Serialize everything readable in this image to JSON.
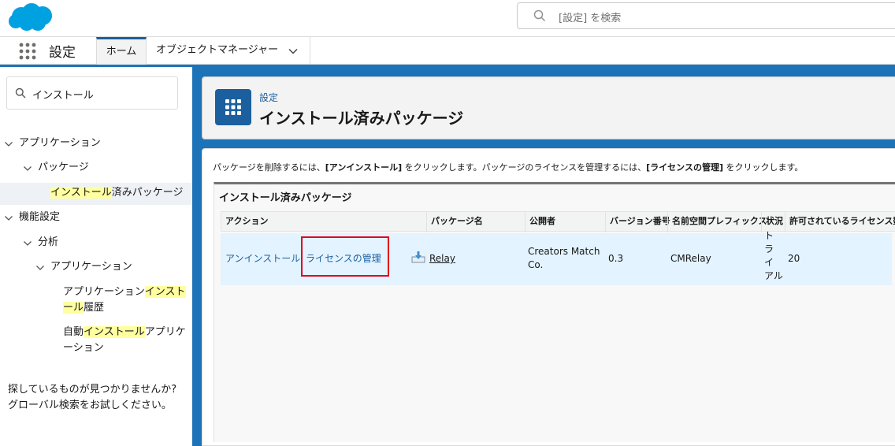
{
  "header": {
    "search_placeholder": "[設定] を検索",
    "brand_color": "#00a1e0"
  },
  "nav": {
    "app_name": "設定",
    "tabs": [
      {
        "label": "ホーム"
      },
      {
        "label": "オブジェクトマネージャー"
      }
    ]
  },
  "sidebar": {
    "quick_find_value": "インストール",
    "tree": {
      "applications": "アプリケーション",
      "packages": "パッケージ",
      "installed_hl": "インストール",
      "installed_rest": "済みパッケージ",
      "feature_settings": "機能設定",
      "analytics": "分析",
      "analytics_apps": "アプリケーション",
      "install_history_a": "アプリケーション",
      "install_history_hl1": "インスト",
      "install_history_hl2": "ール",
      "install_history_b": "履歴",
      "auto_a": "自動",
      "auto_hl": "インストール",
      "auto_b": "アプリケ",
      "auto_c": "ーション"
    },
    "help_line1": "探しているものが見つかりませんか?",
    "help_line2": "グローバル検索をお試しください。"
  },
  "page_header": {
    "breadcrumb": "設定",
    "title": "インストール済みパッケージ"
  },
  "content": {
    "desc_1": "パッケージを削除するには、",
    "desc_b1": "[アンインストール]",
    "desc_2": " をクリックします。パッケージのライセンスを管理するには、",
    "desc_b2": "[ライセンスの管理]",
    "desc_3": " をクリックします。",
    "section_title": "インストール済みパッケージ",
    "columns": [
      "アクション",
      "パッケージ名",
      "公開者",
      "バージョン番号",
      "名前空間プレフィックス",
      "状況",
      "許可されているライセンス数"
    ],
    "rows": [
      {
        "uninstall": "アンインストール",
        "manage_licenses": "ライセンスの管理",
        "package_name": "Relay",
        "publisher_1": "Creators Match",
        "publisher_2": "Co.",
        "version": "0.3",
        "namespace": "CMRelay",
        "status_chars": [
          "ト",
          "ラ",
          "イ",
          "アル"
        ],
        "licenses": "20"
      }
    ]
  },
  "colors": {
    "accent": "#1b5f9e",
    "highlight_box": "#e0001b",
    "selected_row": "#e3f3ff",
    "background_blue": "#1d73b8"
  }
}
